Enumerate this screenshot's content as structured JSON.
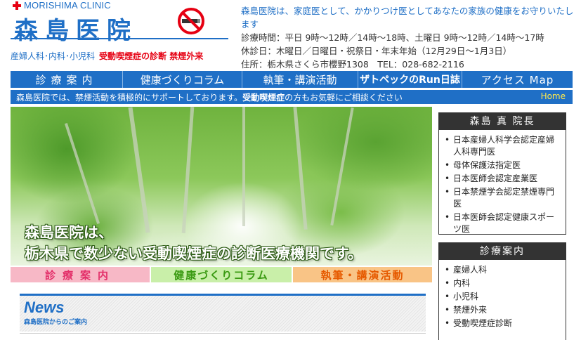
{
  "header": {
    "logo_sub": "MORISHIMA CLINIC",
    "logo_title": "森島医院",
    "depts_normal": "産婦人科･内科･小児科",
    "depts_red": "受動喫煙症の診断 禁煙外来",
    "info_lead": "森島医院は、家庭医として、かかりつけ医としてあなたの家族の健康をお守りいたします",
    "hours": "診療時間：平日 9時〜12時／14時〜18時、土曜日 9時〜12時／14時〜17時",
    "closed": "休診日：木曜日／日曜日・祝祭日・年末年始（12月29日〜1月3日）",
    "address": "住所：栃木県さくら市櫻野1308　TEL：028-682-2116"
  },
  "nav": {
    "items": [
      "診療案内",
      "健康づくりコラム",
      "執筆・講演活動",
      "ザトペックのRun日誌",
      "アクセス Map"
    ]
  },
  "banner": {
    "text_a": "森島医院では、禁煙活動を積極的にサポートしております。",
    "text_b": "受動喫煙症",
    "text_c": "の方もお気軽にご相談ください",
    "home": "Home"
  },
  "hero": {
    "line1": "森島医院は、",
    "line2": "栃木県で数少ない受動喫煙症の診断医療機関です。"
  },
  "subnav": [
    "診療案内",
    "健康づくりコラム",
    "執筆・講演活動"
  ],
  "news": {
    "title": "News",
    "subtitle": "森島医院からのご案内"
  },
  "sidebar": {
    "director": {
      "title": "森島 真 院長",
      "items": [
        "日本産婦人科学会認定産婦人科専門医",
        "母体保護法指定医",
        "日本医師会認定産業医",
        "日本禁煙学会認定禁煙専門医",
        "日本医師会認定健康スポーツ医"
      ]
    },
    "services": {
      "title": "診療案内",
      "items": [
        "産婦人科",
        "内科",
        "小児科",
        "禁煙外来",
        "受動喫煙症診断"
      ]
    }
  },
  "colors": {
    "brand_blue": "#1f6fc6",
    "accent_red": "#e60012"
  }
}
